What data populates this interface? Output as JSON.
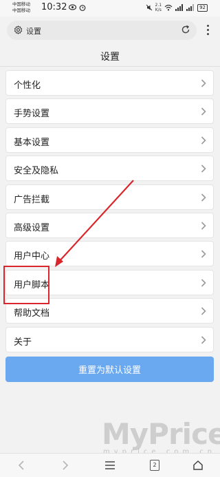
{
  "status_bar": {
    "carrier_1": "中国移动",
    "carrier_2": "中国移动",
    "time": "10:32",
    "speed_value": "2.1",
    "speed_unit": "K/s",
    "battery": "92"
  },
  "address_bar": {
    "text": "设置"
  },
  "page": {
    "title": "设置"
  },
  "settings": {
    "items": [
      {
        "label": "个性化"
      },
      {
        "label": "手势设置"
      },
      {
        "label": "基本设置"
      },
      {
        "label": "安全及隐私"
      },
      {
        "label": "广告拦截"
      },
      {
        "label": "高级设置"
      },
      {
        "label": "用户中心"
      },
      {
        "label": "用户脚本"
      },
      {
        "label": "帮助文档"
      },
      {
        "label": "关于"
      }
    ],
    "reset_label": "重置为默认设置"
  },
  "bottom_nav": {
    "tab_count": "2"
  },
  "watermark": {
    "brand": "MyPrice",
    "site": "myprice.com.cn"
  },
  "colors": {
    "reset_button": "#6aa9f0",
    "annotation": "#d9262c"
  }
}
